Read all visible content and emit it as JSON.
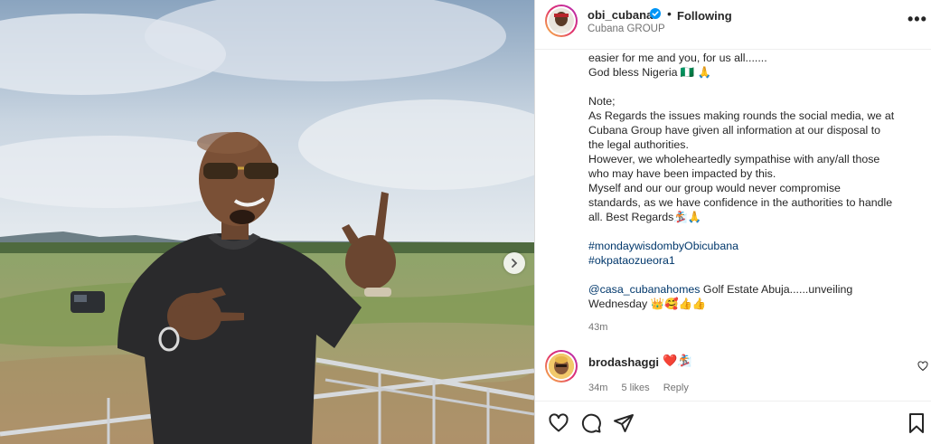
{
  "header": {
    "username": "obi_cubana",
    "separator": "•",
    "follow_label": "Following",
    "subtitle": "Cubana GROUP",
    "more_icon": "•••"
  },
  "caption": {
    "lines": [
      "easier for me and you, for us all.......",
      "God bless Nigeria 🇳🇬 🙏",
      "",
      "Note;",
      "As Regards the issues making rounds the social media, we at",
      "Cubana Group have given all information at our disposal to",
      "the legal authorities.",
      "However, we wholeheartedly sympathise with any/all those",
      "who may have been impacted by this.",
      "Myself and our our group would never compromise",
      "standards, as we have confidence in the authorities to handle",
      "all. Best Regards🏂🙏",
      ""
    ],
    "hashtags": [
      "#mondaywisdombyObicubana",
      "#okpataozueora1"
    ],
    "mention": "@casa_cubanahomes",
    "mention_tail": " Golf Estate Abuja......unveiling",
    "last_line": "Wednesday 👑🥰👍👍",
    "time": "43m"
  },
  "comment": {
    "username": "brodashaggi",
    "text": "❤️🏂",
    "time": "34m",
    "likes": "5 likes",
    "reply": "Reply"
  },
  "icons": {
    "verified": "verified-badge-icon",
    "next": "chevron-right-icon",
    "like": "heart-icon",
    "comment": "comment-icon",
    "share": "share-icon",
    "save": "bookmark-icon"
  },
  "colors": {
    "accent_blue": "#0095f6",
    "link_blue": "#00376b",
    "muted": "#737373"
  }
}
